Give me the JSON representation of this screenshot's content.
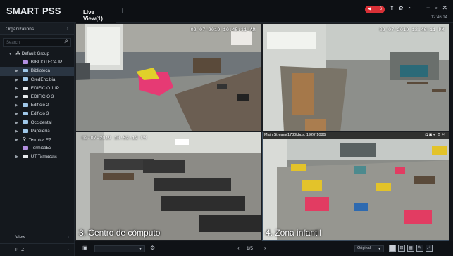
{
  "app": {
    "title": "SMART PSS"
  },
  "tabs": [
    {
      "label": "Live View(1)"
    }
  ],
  "header": {
    "alarm_count": "6",
    "clock": "12:46:14"
  },
  "sidebar": {
    "section_title": "Organizations",
    "search_placeholder": "Search",
    "tree": [
      {
        "label": "Default Group",
        "icon": "group-icon",
        "level": 0,
        "expanded": true
      },
      {
        "label": "BIBLIOTECA IP",
        "icon": "camera-icon",
        "level": 2
      },
      {
        "label": "Biblioteca",
        "icon": "dvr-icon",
        "level": 1,
        "selected": true
      },
      {
        "label": "CredEnc.bia",
        "icon": "dvr-icon",
        "level": 1
      },
      {
        "label": "EDIFICIO 1 IP",
        "icon": "nvr-icon",
        "level": 1
      },
      {
        "label": "EDIFICIO 3",
        "icon": "nvr-icon",
        "level": 1
      },
      {
        "label": "Edificio 2",
        "icon": "dvr-icon",
        "level": 1
      },
      {
        "label": "Edificio 3",
        "icon": "dvr-icon",
        "level": 1
      },
      {
        "label": "Occidental",
        "icon": "dvr-icon",
        "level": 1
      },
      {
        "label": "Papelería",
        "icon": "dvr-icon",
        "level": 1
      },
      {
        "label": "Terrnica E2",
        "icon": "location-icon",
        "level": 1
      },
      {
        "label": "TermicaE3",
        "icon": "camera-icon",
        "level": 2
      },
      {
        "label": "UT Tamazula",
        "icon": "nvr-icon",
        "level": 1
      }
    ],
    "footer": [
      {
        "label": "View"
      },
      {
        "label": "PTZ"
      }
    ]
  },
  "video": {
    "cells": [
      {
        "timestamp": "02-07-2019 10:45:11 AM",
        "name": ""
      },
      {
        "timestamp": "02-07-2019 12:46:11 PM",
        "name": ""
      },
      {
        "timestamp": "02-07-2019 10:52:12 PM",
        "name": "3. Centro de cómputo"
      },
      {
        "timestamp": "",
        "name": "4. Zona infantil",
        "stream": "Main Stream(1730kbps, 1920*1080)"
      }
    ]
  },
  "bottombar": {
    "page": "1/5",
    "stream_quality": "Original"
  }
}
